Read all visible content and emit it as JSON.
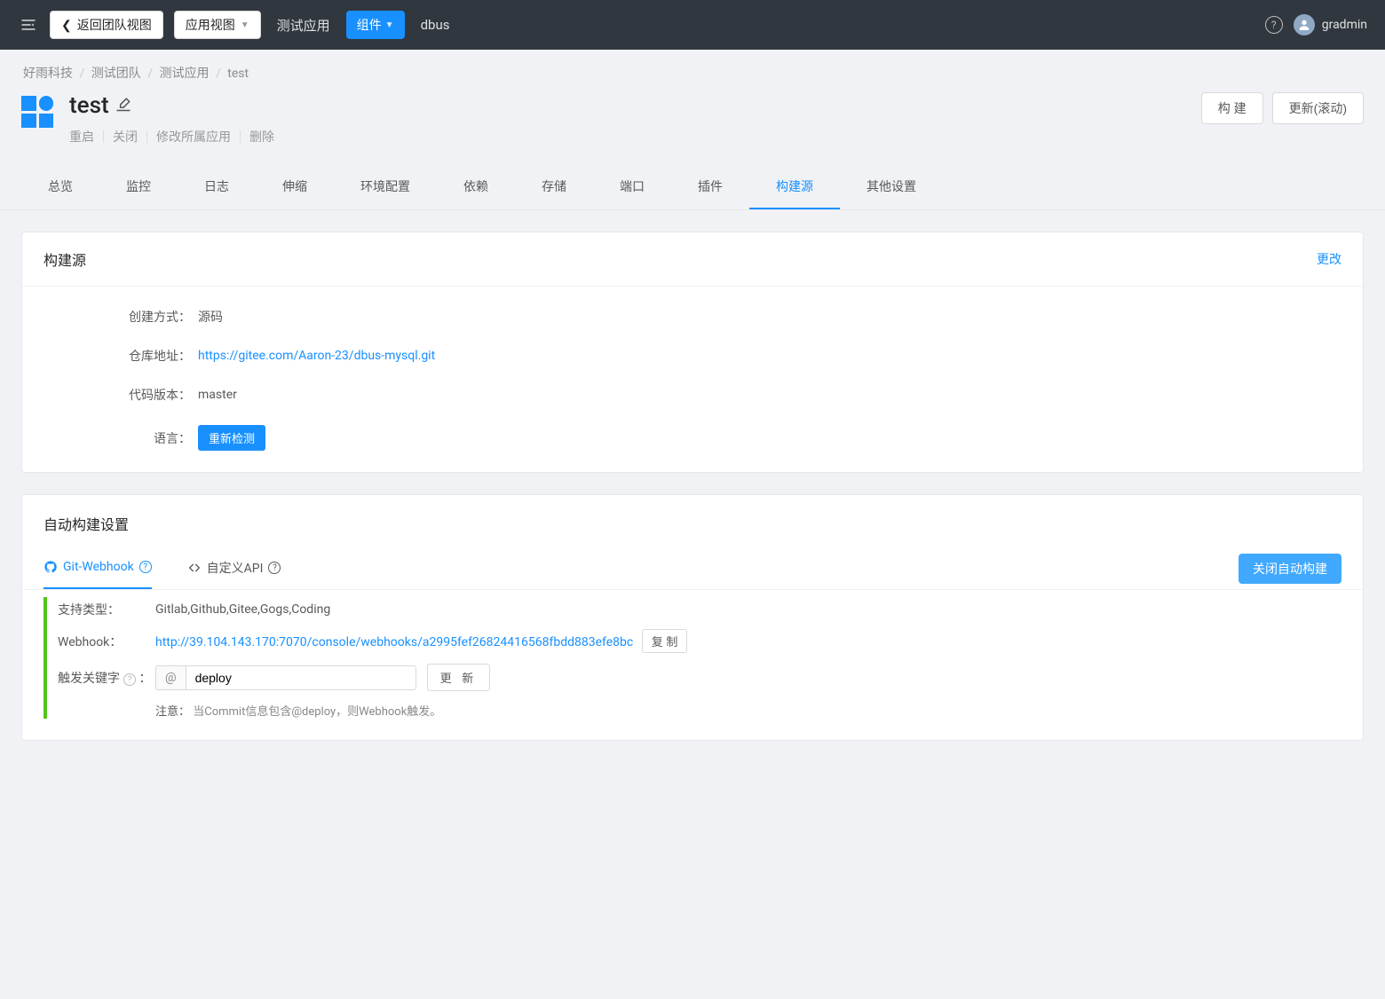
{
  "topbar": {
    "back_label": "返回团队视图",
    "view_label": "应用视图",
    "app_name": "测试应用",
    "components_label": "组件",
    "component_name": "dbus",
    "username": "gradmin"
  },
  "breadcrumb": {
    "items": [
      "好雨科技",
      "测试团队",
      "测试应用",
      "test"
    ]
  },
  "header": {
    "title": "test",
    "sub_actions": [
      "重启",
      "关闭",
      "修改所属应用",
      "删除"
    ],
    "build_btn": "构 建",
    "update_btn": "更新(滚动)"
  },
  "tabs": [
    "总览",
    "监控",
    "日志",
    "伸缩",
    "环境配置",
    "依赖",
    "存储",
    "端口",
    "插件",
    "构建源",
    "其他设置"
  ],
  "active_tab": "构建源",
  "source_card": {
    "title": "构建源",
    "change": "更改",
    "rows": {
      "create_method": {
        "label": "创建方式",
        "value": "源码"
      },
      "repo_url": {
        "label": "仓库地址",
        "value": "https://gitee.com/Aaron-23/dbus-mysql.git"
      },
      "code_version": {
        "label": "代码版本",
        "value": "master"
      },
      "language": {
        "label": "语言",
        "btn": "重新检测"
      }
    }
  },
  "auto_build": {
    "title": "自动构建设置",
    "tabs": {
      "git_webhook": "Git-Webhook",
      "custom_api": "自定义API"
    },
    "toggle_btn": "关闭自动构建",
    "support": {
      "label": "支持类型：",
      "value": "Gitlab,Github,Gitee,Gogs,Coding"
    },
    "webhook": {
      "label": "Webhook：",
      "url": "http://39.104.143.170:7070/console/webhooks/a2995fef26824416568fbdd883efe8bc",
      "copy": "复 制"
    },
    "trigger": {
      "label": "触发关键字",
      "prefix": "@",
      "value": "deploy",
      "update": "更 新"
    },
    "note": {
      "label": "注意：",
      "text": "当Commit信息包含@deploy，则Webhook触发。"
    }
  }
}
